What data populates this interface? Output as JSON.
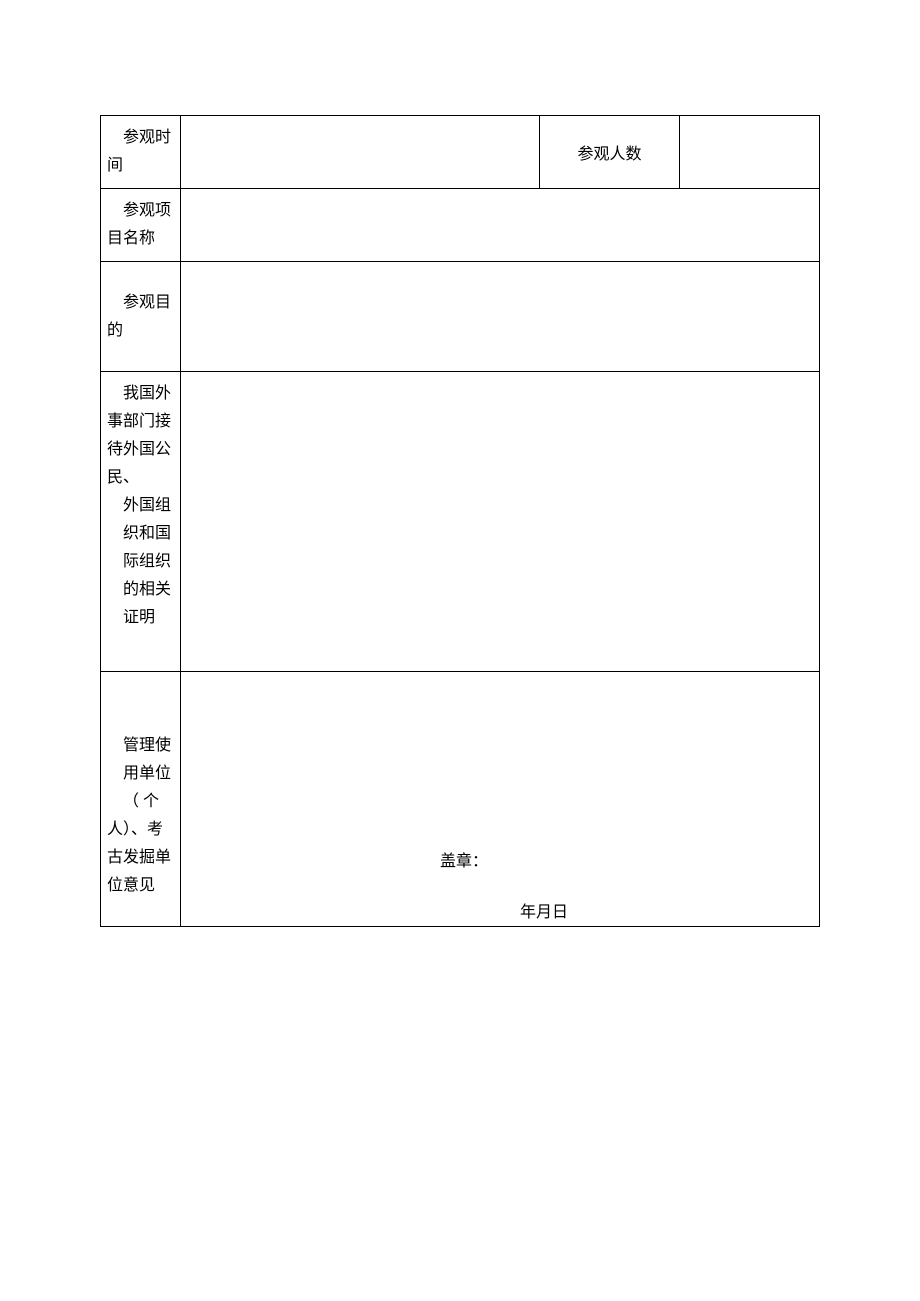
{
  "rows": {
    "visitTime": {
      "label_line1": "参观时",
      "label_line2": "间",
      "value": ""
    },
    "visitorCount": {
      "label": "参观人数",
      "value": ""
    },
    "projectName": {
      "label_line1": "参观项",
      "label_line2": "目名称",
      "value": ""
    },
    "purpose": {
      "label_line1": "参观目",
      "label_line2": "的",
      "value": ""
    },
    "foreignAffairs": {
      "label_line1": "我国外",
      "label_line2": "事部门接",
      "label_line3": "待外国公",
      "label_line4": "民、",
      "label_line5": "外国组",
      "label_line6": "织和国",
      "label_line7": "际组织",
      "label_line8": "的相关",
      "label_line9": "证明",
      "value": ""
    },
    "opinion": {
      "label_line1": "管理使",
      "label_line2": "用单位",
      "label_line3": "（ 个",
      "label_line4": "人）、考",
      "label_line5": "古发掘单",
      "label_line6": "位意见",
      "seal": "盖章：",
      "date": "年月日"
    }
  }
}
